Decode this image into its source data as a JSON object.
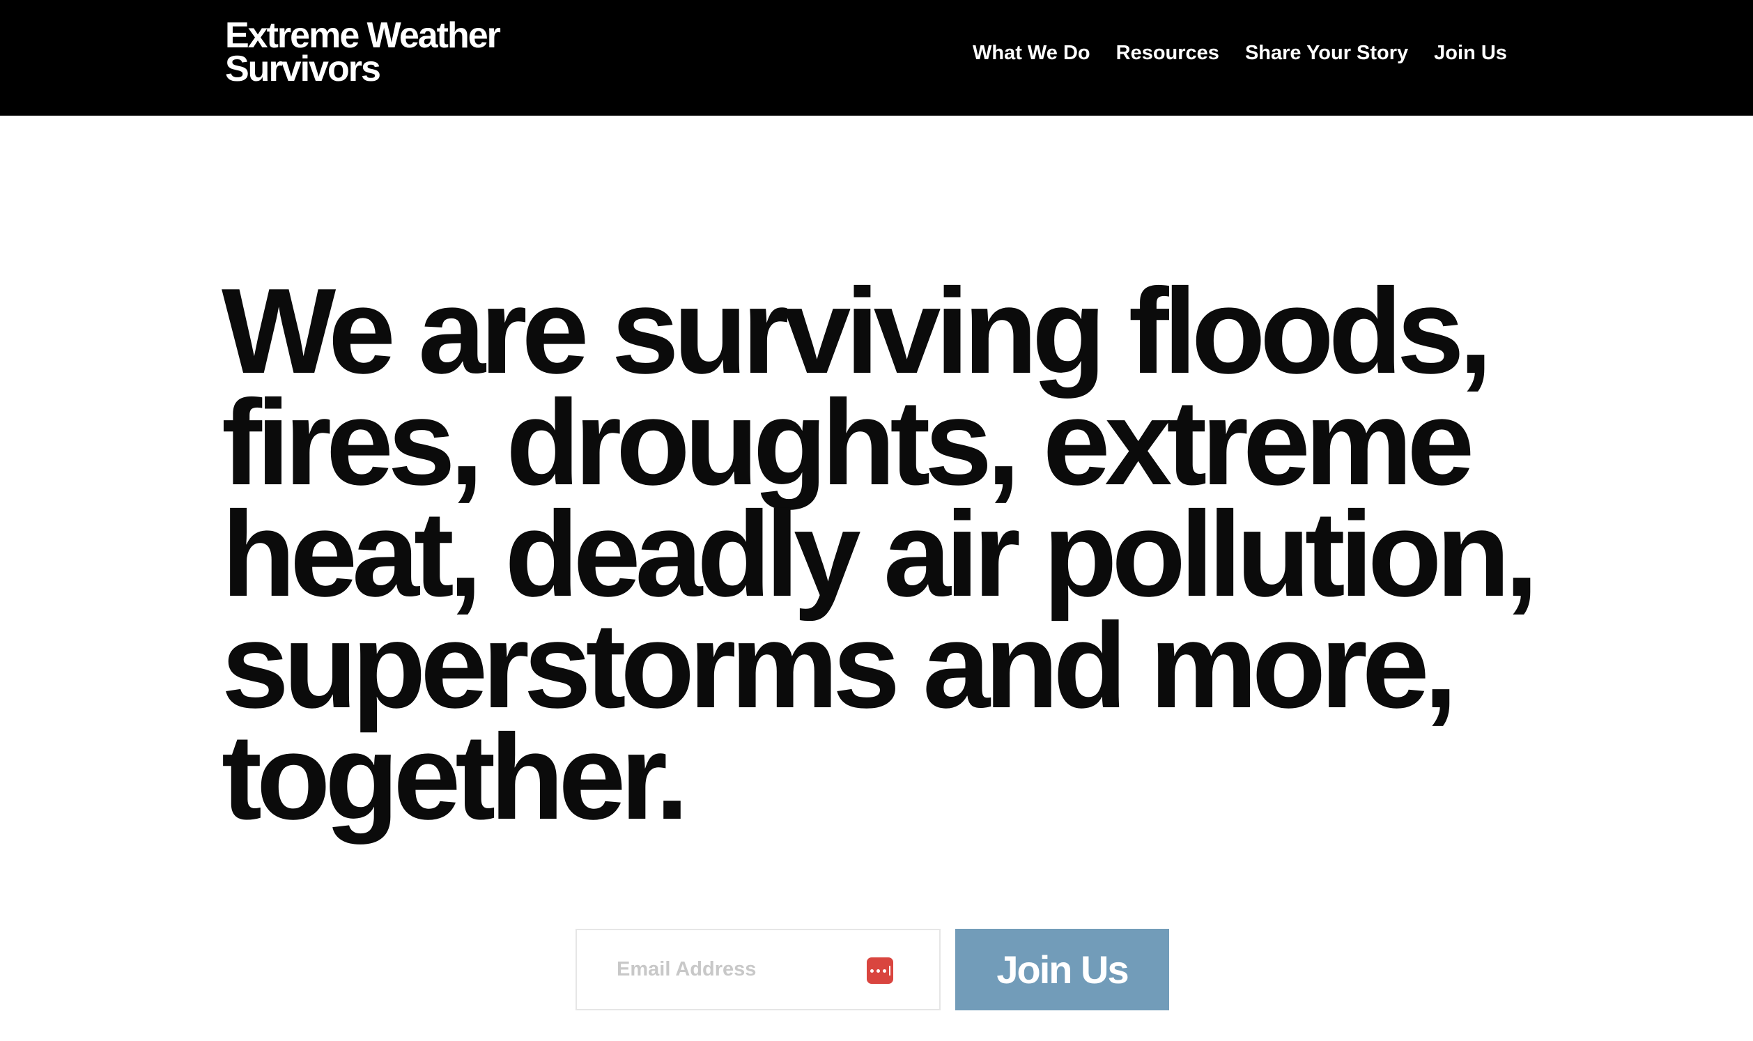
{
  "header": {
    "logo_line1": "Extreme Weather",
    "logo_line2": "Survivors",
    "nav": [
      {
        "label": "What We Do"
      },
      {
        "label": "Resources"
      },
      {
        "label": "Share Your Story"
      },
      {
        "label": "Join Us"
      }
    ]
  },
  "hero": {
    "headline": "We are surviving floods, fires, droughts, extreme heat, deadly air pollution, superstorms and more, together."
  },
  "signup": {
    "email_placeholder": "Email Address",
    "email_value": "",
    "password_manager_icon": "password-manager-icon",
    "button_label": "Join Us"
  },
  "colors": {
    "header_bg": "#000000",
    "button_bg": "#729cb9",
    "icon_red": "#d9453f",
    "text": "#0b0b0b"
  }
}
